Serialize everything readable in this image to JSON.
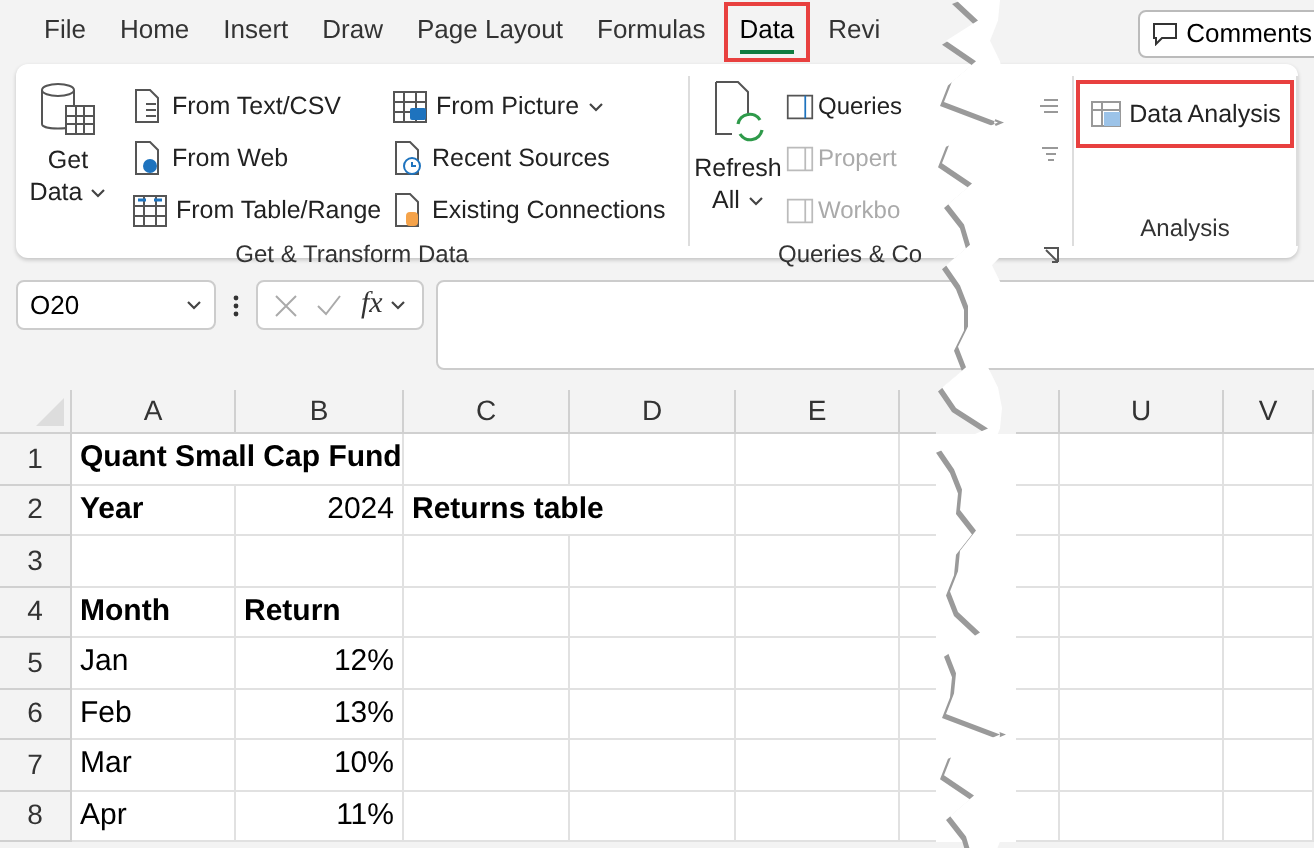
{
  "tabs": [
    {
      "label": "File",
      "selected": false,
      "highlighted": false
    },
    {
      "label": "Home",
      "selected": false,
      "highlighted": false
    },
    {
      "label": "Insert",
      "selected": false,
      "highlighted": false
    },
    {
      "label": "Draw",
      "selected": false,
      "highlighted": false
    },
    {
      "label": "Page Layout",
      "selected": false,
      "highlighted": false
    },
    {
      "label": "Formulas",
      "selected": false,
      "highlighted": false
    },
    {
      "label": "Data",
      "selected": true,
      "highlighted": true
    },
    {
      "label": "Revi",
      "selected": false,
      "highlighted": false
    }
  ],
  "comments_button": {
    "label": "Comments"
  },
  "get_transform": {
    "label": "Get & Transform Data",
    "get_data": {
      "line1": "Get",
      "line2": "Data"
    },
    "columns": [
      [
        {
          "label": "From Text/CSV",
          "dropdown": false
        },
        {
          "label": "From Web",
          "dropdown": false
        },
        {
          "label": "From Table/Range",
          "dropdown": false
        }
      ],
      [
        {
          "label": "From Picture",
          "dropdown": true
        },
        {
          "label": "Recent Sources",
          "dropdown": false
        },
        {
          "label": "Existing Connections",
          "dropdown": false
        }
      ]
    ]
  },
  "queries": {
    "label": "Queries & Co",
    "refresh": {
      "line1": "Refresh",
      "line2": "All"
    },
    "items": [
      {
        "label": "Queries",
        "disabled": false
      },
      {
        "label": "Propert",
        "disabled": true
      },
      {
        "label": "Workbo",
        "disabled": true
      }
    ]
  },
  "analysis": {
    "label": "Analysis",
    "button": {
      "label": "Data Analysis",
      "highlighted": true
    }
  },
  "formula_bar": {
    "name_box": "O20",
    "function_label": "fx"
  },
  "sheet": {
    "columns": [
      "A",
      "B",
      "C",
      "D",
      "E",
      "U",
      "V"
    ],
    "rows": [
      {
        "number": "1",
        "a": {
          "text": "Quant Small Cap Fund",
          "bold": true,
          "kind": "text"
        }
      },
      {
        "number": "2",
        "a": {
          "text": "Year",
          "bold": true,
          "kind": "text"
        },
        "b": {
          "text": "2024",
          "bold": false,
          "kind": "number"
        },
        "c": {
          "text": "Returns table",
          "bold": true,
          "kind": "text"
        }
      },
      {
        "number": "3"
      },
      {
        "number": "4",
        "a": {
          "text": "Month",
          "bold": true,
          "kind": "text"
        },
        "b": {
          "text": "Return",
          "bold": true,
          "kind": "text"
        }
      },
      {
        "number": "5",
        "a": {
          "text": "Jan",
          "bold": false,
          "kind": "text"
        },
        "b": {
          "text": "12%",
          "bold": false,
          "kind": "number"
        }
      },
      {
        "number": "6",
        "a": {
          "text": "Feb",
          "bold": false,
          "kind": "text"
        },
        "b": {
          "text": "13%",
          "bold": false,
          "kind": "number"
        }
      },
      {
        "number": "7",
        "a": {
          "text": "Mar",
          "bold": false,
          "kind": "text"
        },
        "b": {
          "text": "10%",
          "bold": false,
          "kind": "number"
        }
      },
      {
        "number": "8",
        "a": {
          "text": "Apr",
          "bold": false,
          "kind": "text"
        },
        "b": {
          "text": "11%",
          "bold": false,
          "kind": "number"
        }
      }
    ]
  }
}
